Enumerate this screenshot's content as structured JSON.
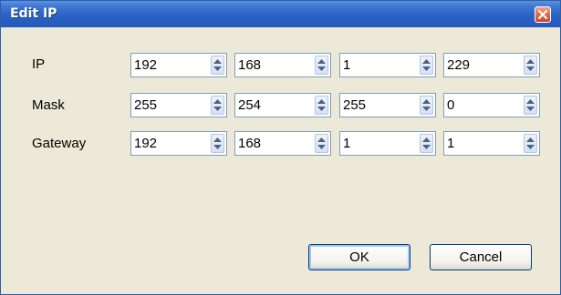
{
  "window": {
    "title": "Edit IP"
  },
  "rows": [
    {
      "label": "IP",
      "values": [
        "192",
        "168",
        "1",
        "229"
      ]
    },
    {
      "label": "Mask",
      "values": [
        "255",
        "254",
        "255",
        "0"
      ]
    },
    {
      "label": "Gateway",
      "values": [
        "192",
        "168",
        "1",
        "1"
      ]
    }
  ],
  "buttons": {
    "ok": "OK",
    "cancel": "Cancel"
  },
  "icons": {
    "close": "close-icon",
    "up": "up-arrow-icon",
    "down": "down-arrow-icon"
  },
  "colors": {
    "titlebar": "#2a63c4",
    "background": "#ece9d8",
    "close": "#e06a4c"
  }
}
